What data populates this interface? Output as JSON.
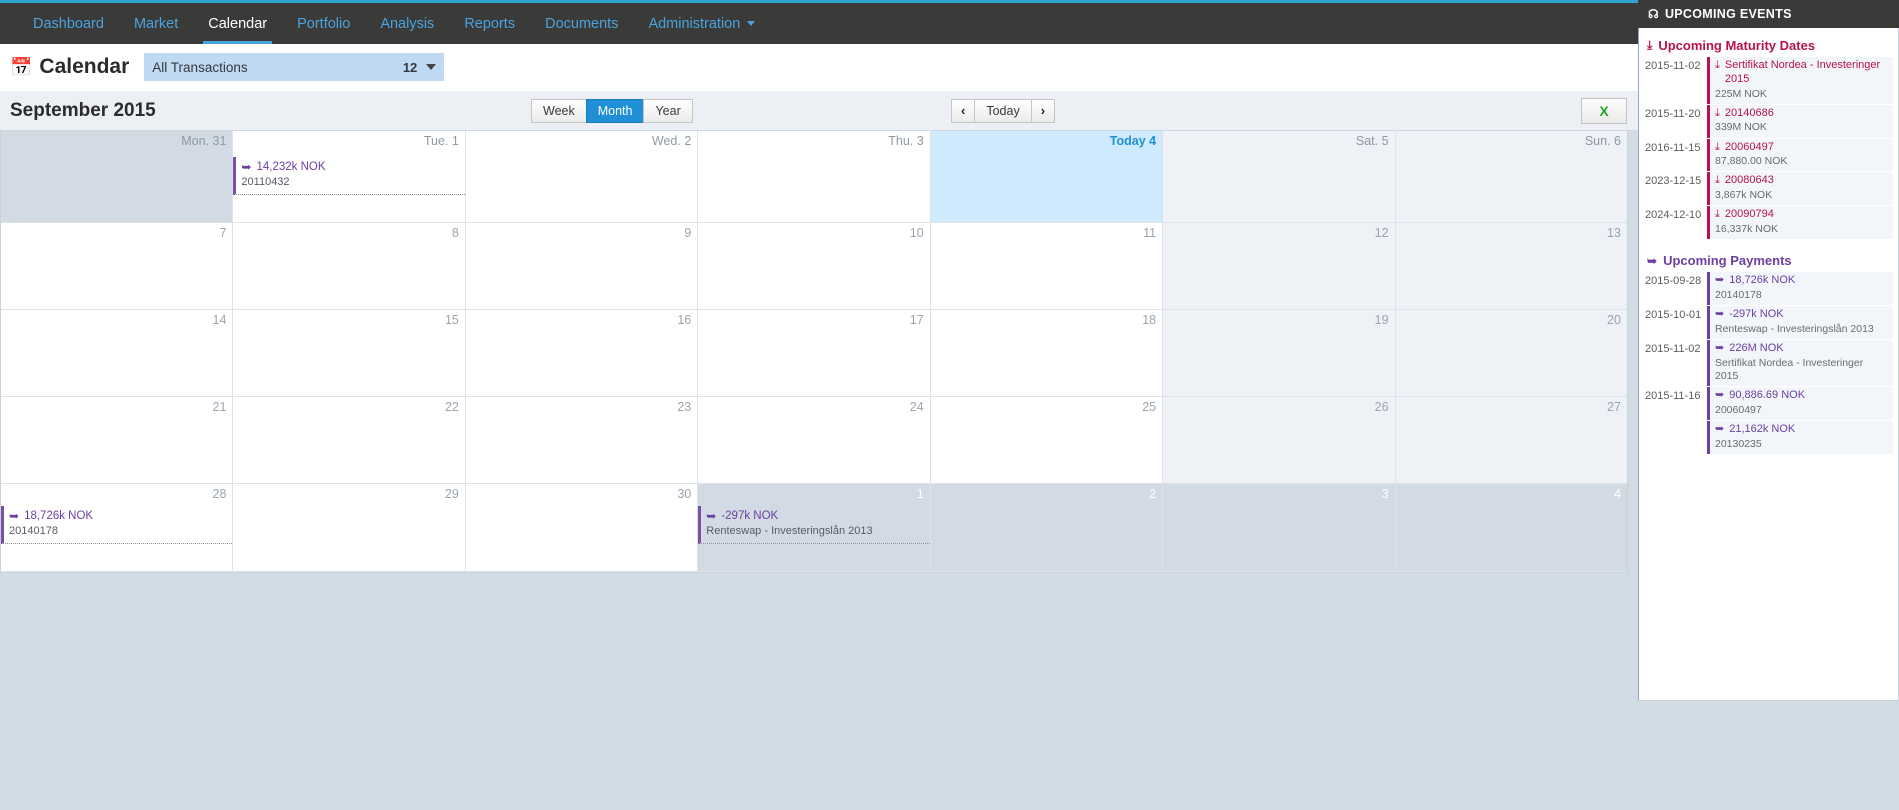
{
  "nav": {
    "items": [
      {
        "label": "Dashboard",
        "active": false,
        "caret": false
      },
      {
        "label": "Market",
        "active": false,
        "caret": false
      },
      {
        "label": "Calendar",
        "active": true,
        "caret": false
      },
      {
        "label": "Portfolio",
        "active": false,
        "caret": false
      },
      {
        "label": "Analysis",
        "active": false,
        "caret": false
      },
      {
        "label": "Reports",
        "active": false,
        "caret": false
      },
      {
        "label": "Documents",
        "active": false,
        "caret": false
      },
      {
        "label": "Administration",
        "active": false,
        "caret": true
      }
    ]
  },
  "header": {
    "title": "Calendar",
    "calendar_icon": "calendar-icon",
    "filter": {
      "label": "All Transactions",
      "count": "12",
      "icon": "chevron-down-icon"
    }
  },
  "toolbar": {
    "month_title": "September 2015",
    "views": [
      {
        "label": "Week",
        "active": false
      },
      {
        "label": "Month",
        "active": true
      },
      {
        "label": "Year",
        "active": false
      }
    ],
    "prev_label": "‹",
    "today_label": "Today",
    "next_label": "›",
    "export_label": "X",
    "export_icon": "excel-export-icon"
  },
  "calendar": {
    "weekday_headers": [
      "Mon. 31",
      "Tue. 1",
      "Wed. 2",
      "Thu. 3",
      "Today 4",
      "Sat. 5",
      "Sun. 6"
    ],
    "rows": [
      {
        "cells": [
          {
            "day": "Mon. 31",
            "state": "other-head",
            "events": []
          },
          {
            "day": "Tue. 1",
            "state": "head",
            "events": [
              {
                "amount": "14,232k NOK",
                "desc": "20110432",
                "icon": "payment-arrow-icon"
              }
            ]
          },
          {
            "day": "Wed. 2",
            "state": "head",
            "events": []
          },
          {
            "day": "Thu. 3",
            "state": "head",
            "events": []
          },
          {
            "day": "Today 4",
            "state": "today-head",
            "events": []
          },
          {
            "day": "Sat. 5",
            "state": "weekend-head",
            "events": []
          },
          {
            "day": "Sun. 6",
            "state": "weekend-head",
            "events": []
          }
        ]
      },
      {
        "cells": [
          {
            "day": "7",
            "state": "normal",
            "events": []
          },
          {
            "day": "8",
            "state": "normal",
            "events": []
          },
          {
            "day": "9",
            "state": "normal",
            "events": []
          },
          {
            "day": "10",
            "state": "normal",
            "events": []
          },
          {
            "day": "11",
            "state": "normal",
            "events": []
          },
          {
            "day": "12",
            "state": "weekend",
            "events": []
          },
          {
            "day": "13",
            "state": "weekend",
            "events": []
          }
        ]
      },
      {
        "cells": [
          {
            "day": "14",
            "state": "normal",
            "events": []
          },
          {
            "day": "15",
            "state": "normal",
            "events": []
          },
          {
            "day": "16",
            "state": "normal",
            "events": []
          },
          {
            "day": "17",
            "state": "normal",
            "events": []
          },
          {
            "day": "18",
            "state": "normal",
            "events": []
          },
          {
            "day": "19",
            "state": "weekend",
            "events": []
          },
          {
            "day": "20",
            "state": "weekend",
            "events": []
          }
        ]
      },
      {
        "cells": [
          {
            "day": "21",
            "state": "normal",
            "events": []
          },
          {
            "day": "22",
            "state": "normal",
            "events": []
          },
          {
            "day": "23",
            "state": "normal",
            "events": []
          },
          {
            "day": "24",
            "state": "normal",
            "events": []
          },
          {
            "day": "25",
            "state": "normal",
            "events": []
          },
          {
            "day": "26",
            "state": "weekend",
            "events": []
          },
          {
            "day": "27",
            "state": "weekend",
            "events": []
          }
        ]
      },
      {
        "cells": [
          {
            "day": "28",
            "state": "normal",
            "events": [
              {
                "amount": "18,726k NOK",
                "desc": "20140178",
                "icon": "payment-arrow-icon"
              }
            ]
          },
          {
            "day": "29",
            "state": "normal",
            "events": []
          },
          {
            "day": "30",
            "state": "normal",
            "events": []
          },
          {
            "day": "1",
            "state": "other",
            "events": [
              {
                "amount": "-297k NOK",
                "desc": "Renteswap - Investeringslån 2013",
                "icon": "payment-arrow-icon"
              }
            ]
          },
          {
            "day": "2",
            "state": "other",
            "events": []
          },
          {
            "day": "3",
            "state": "other",
            "events": []
          },
          {
            "day": "4",
            "state": "other",
            "events": []
          }
        ]
      }
    ]
  },
  "sidebar": {
    "title": "UPCOMING EVENTS",
    "title_icon": "bell-icon",
    "sections": [
      {
        "id": "maturity",
        "title": "Upcoming Maturity Dates",
        "icon": "maturity-upload-icon",
        "accent": "#b6124f",
        "rows": [
          {
            "date": "2015-11-02",
            "title": "Sertifikat Nordea - Investeringer 2015",
            "desc": "225M NOK",
            "icon": "maturity-upload-icon"
          },
          {
            "date": "2015-11-20",
            "title": "20140686",
            "desc": "339M NOK",
            "icon": "maturity-upload-icon"
          },
          {
            "date": "2016-11-15",
            "title": "20060497",
            "desc": "87,880.00 NOK",
            "icon": "maturity-upload-icon"
          },
          {
            "date": "2023-12-15",
            "title": "20080643",
            "desc": "3,867k NOK",
            "icon": "maturity-upload-icon"
          },
          {
            "date": "2024-12-10",
            "title": "20090794",
            "desc": "16,337k NOK",
            "icon": "maturity-upload-icon"
          }
        ]
      },
      {
        "id": "payments",
        "title": "Upcoming Payments",
        "icon": "payment-arrow-icon",
        "accent": "#6c3fa0",
        "rows": [
          {
            "date": "2015-09-28",
            "title": "18,726k NOK",
            "desc": "20140178",
            "icon": "payment-arrow-icon"
          },
          {
            "date": "2015-10-01",
            "title": "-297k NOK",
            "desc": "Renteswap - Investeringslån 2013",
            "icon": "payment-arrow-icon"
          },
          {
            "date": "2015-11-02",
            "title": "226M NOK",
            "desc": "Sertifikat Nordea - Investeringer 2015",
            "icon": "payment-arrow-icon"
          },
          {
            "date": "2015-11-16",
            "title": "90,886.69 NOK",
            "desc": "20060497",
            "icon": "payment-arrow-icon"
          },
          {
            "date": "",
            "title": "21,162k NOK",
            "desc": "20130235",
            "icon": "payment-arrow-icon"
          }
        ]
      }
    ]
  },
  "colors": {
    "nav_bg": "#3a3a38",
    "nav_link": "#4aa3df",
    "accent_blue": "#1f8fd6",
    "page_bg": "#d2dce5",
    "maturity": "#b6124f",
    "payment": "#6c3fa0",
    "today_bg": "#cfeafc",
    "excel_green": "#26a524"
  }
}
